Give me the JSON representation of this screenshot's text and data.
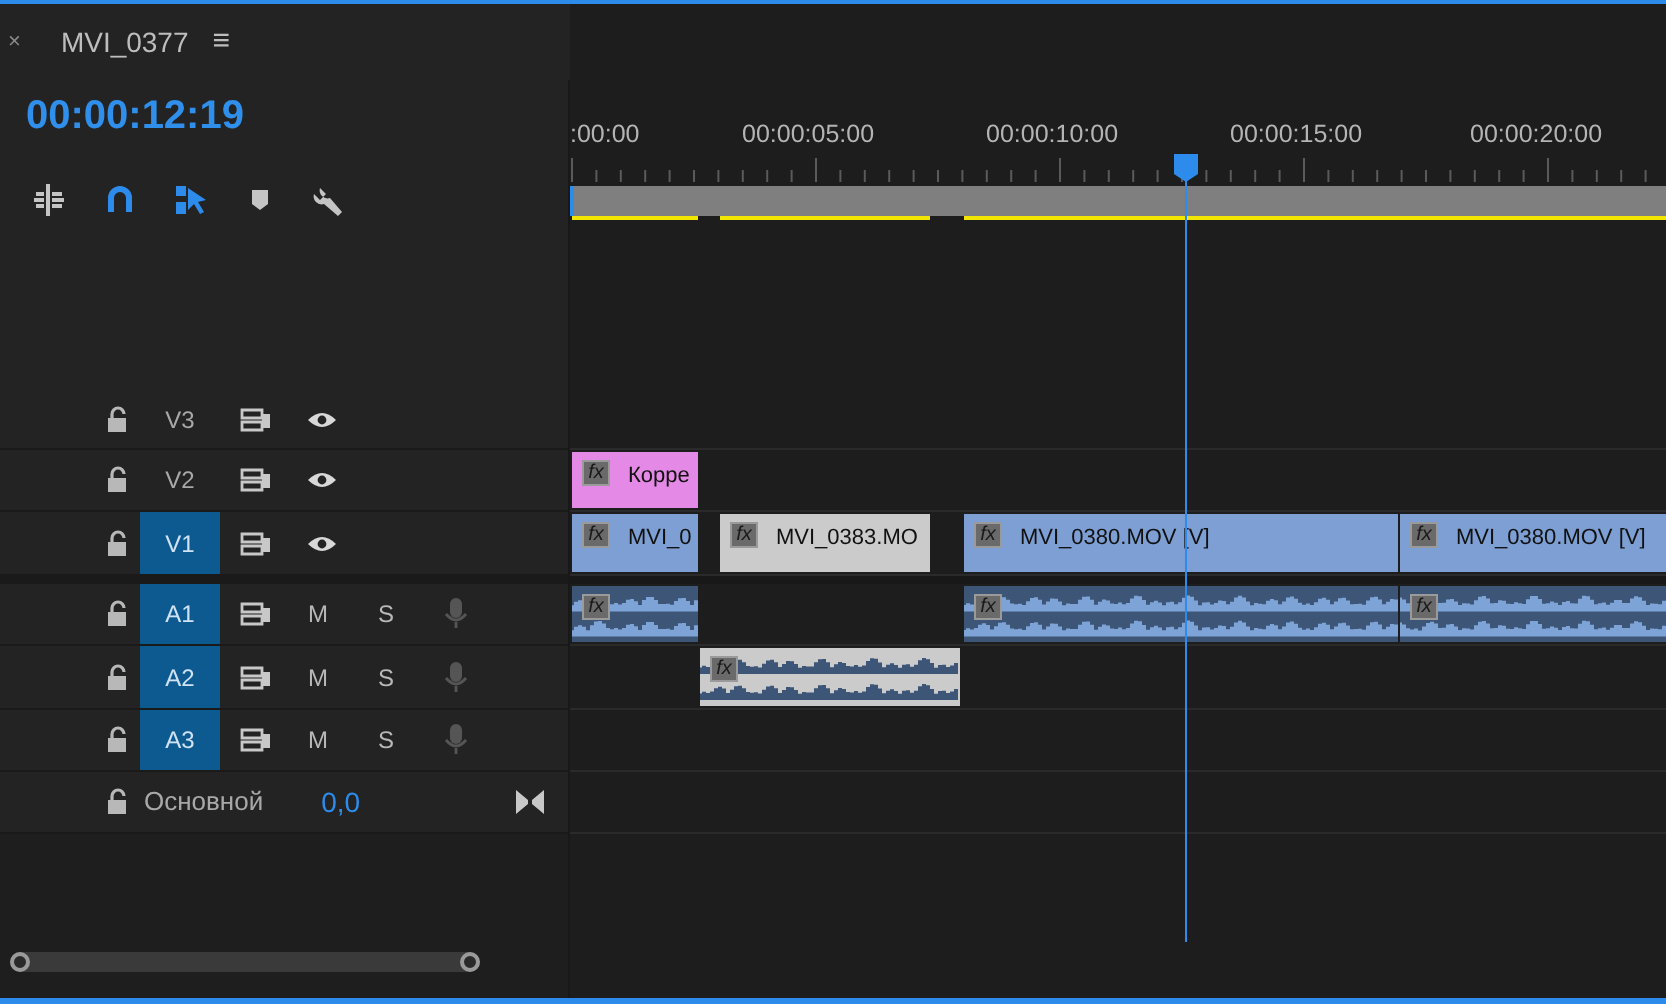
{
  "sequence_tab": {
    "close": "×",
    "title": "MVI_0377",
    "menu": "≡"
  },
  "timecode": "00:00:12:19",
  "tools": [
    {
      "kind": "insert",
      "on": false
    },
    {
      "kind": "snap",
      "on": true
    },
    {
      "kind": "linked",
      "on": true
    },
    {
      "kind": "marker",
      "on": false
    },
    {
      "kind": "settings",
      "on": false
    }
  ],
  "ruler": {
    "labels": [
      ":00:00",
      "00:00:05:00",
      "00:00:10:00",
      "00:00:15:00",
      "00:00:20:00"
    ]
  },
  "tracks": [
    {
      "kind": "video",
      "label": "V3",
      "targeted": false
    },
    {
      "kind": "video",
      "label": "V2",
      "targeted": false,
      "clips": [
        {
          "label": "Корре",
          "badge": "fx",
          "color": "#e589e6"
        }
      ]
    },
    {
      "kind": "video",
      "label": "V1",
      "targeted": true,
      "clips": [
        {
          "label": "MVI_0",
          "badge": "fx",
          "color": "#7d9fd3"
        },
        {
          "label": "MVI_0383.MO",
          "badge": "fx",
          "color": "#cbcbcb"
        },
        {
          "label": "MVI_0380.MOV [V]",
          "badge": "fx",
          "color": "#7d9fd3"
        },
        {
          "label": "MVI_0380.MOV [V]",
          "badge": "fx",
          "color": "#7d9fd3"
        }
      ]
    },
    {
      "kind": "audio",
      "label": "A1",
      "targeted": true,
      "mute": "M",
      "solo": "S",
      "clips": [
        {
          "badge": "fx",
          "color": "#3d5678"
        },
        {
          "badge": "fx",
          "color": "#3d5678"
        },
        {
          "badge": "fx",
          "color": "#3d5678"
        }
      ]
    },
    {
      "kind": "audio",
      "label": "A2",
      "targeted": true,
      "mute": "M",
      "solo": "S",
      "clips": [
        {
          "badge": "fx",
          "color": "#cbcbcb"
        }
      ]
    },
    {
      "kind": "audio",
      "label": "A3",
      "targeted": true,
      "mute": "M",
      "solo": "S"
    },
    {
      "kind": "master",
      "label": "Основной",
      "value": "0,0"
    }
  ]
}
